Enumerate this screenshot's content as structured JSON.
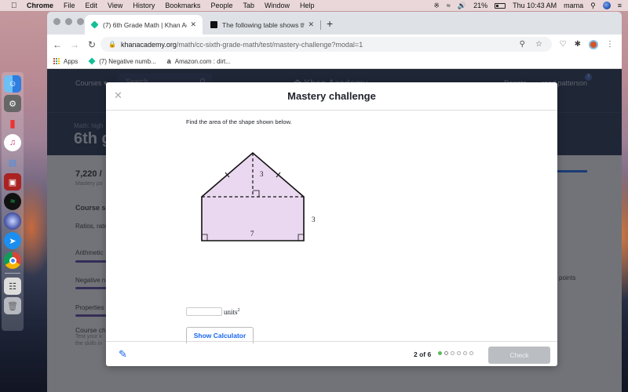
{
  "menubar": {
    "app_name": "Chrome",
    "items": [
      "File",
      "Edit",
      "View",
      "History",
      "Bookmarks",
      "People",
      "Tab",
      "Window",
      "Help"
    ],
    "battery": "21%",
    "clock": "Thu 10:43 AM",
    "user": "mama"
  },
  "dock": {
    "apps": [
      "finder",
      "system-preferences",
      "numbers",
      "itunes",
      "keynote",
      "photo-booth",
      "spotify",
      "siri",
      "safari",
      "chrome",
      "news",
      "trash"
    ]
  },
  "browser": {
    "tabs": [
      {
        "title": "(7) 6th Grade Math | Khan Aca",
        "active": true
      },
      {
        "title": "The following table shows the",
        "active": false
      }
    ],
    "url_domain": "khanacademy.org",
    "url_path": "/math/cc-sixth-grade-math/test/mastery-challenge?modal=1",
    "bookmarks": [
      {
        "label": "Apps"
      },
      {
        "label": "(7) Negative numb..."
      },
      {
        "label": "Amazon.com : dirt..."
      }
    ]
  },
  "khan": {
    "courses": "Courses",
    "search_placeholder": "Search",
    "logo": "Khan Academy",
    "donate": "Donate",
    "user": "reed patterson",
    "notifications": "7",
    "breadcrumb": "Math: high",
    "course_title": "6th g",
    "mastery_points": "7,220 /",
    "mastery_sub": "Mastery po",
    "course_summary": "Course su",
    "units": [
      "Ratios, rate",
      "Arithmetic",
      "Negative n",
      "Properties"
    ],
    "course_challenge": "Course cha",
    "course_challenge_desc1": "Test your k",
    "course_challenge_desc2": "the skills in",
    "points_right": "points"
  },
  "modal": {
    "title": "Mastery challenge",
    "question": "Find the area of the shape shown below.",
    "figure": {
      "triangle_height": "3",
      "rect_width": "7",
      "rect_height": "3",
      "fill": "#ead8f0"
    },
    "answer_value": "",
    "units_label": "units",
    "units_exp": "2",
    "show_calculator": "Show Calculator",
    "progress": "2 of 6",
    "progress_total": 6,
    "progress_done": 1,
    "check": "Check"
  }
}
